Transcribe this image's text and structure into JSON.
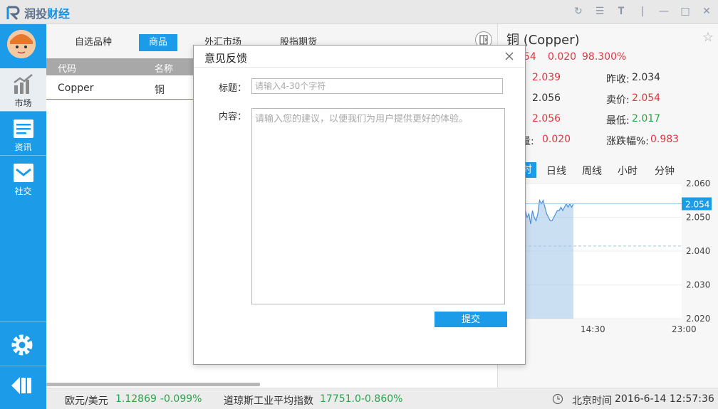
{
  "app": {
    "logo_part1": "润投",
    "logo_part2": "财经"
  },
  "window_controls": [
    "refresh-icon",
    "menu-icon",
    "font-size-icon",
    "minimize-icon",
    "maximize-icon",
    "close-icon"
  ],
  "sidebar": {
    "items": [
      {
        "label": "市场",
        "icon": "chart-icon",
        "active": true
      },
      {
        "label": "资讯",
        "icon": "news-icon",
        "active": false
      },
      {
        "label": "社交",
        "icon": "mail-icon",
        "active": false
      }
    ]
  },
  "main": {
    "tabs": [
      {
        "label": "自选品种",
        "active": false
      },
      {
        "label": "商品",
        "active": true
      },
      {
        "label": "外汇市场",
        "active": false
      },
      {
        "label": "股指期货",
        "active": false
      }
    ],
    "columns": [
      "代码",
      "名称"
    ],
    "rows": [
      {
        "code": "Copper",
        "name": "铜"
      }
    ]
  },
  "status_bar": {
    "fx_label": "欧元/美元",
    "fx_value": "1.12869",
    "fx_change": "-0.099%",
    "index_label": "道琼斯工业平均指数",
    "index_value": "17751.0",
    "index_change": "-0.860%",
    "time_label": "北京时间",
    "time_value": "2016-6-14 12:57:36"
  },
  "quote": {
    "title": "铜 (Copper)",
    "price_partial": "54",
    "change": "0.020",
    "change_pct": "98.300%",
    "open_value": "2.039",
    "prev_close_label": "昨收:",
    "prev_close_value": "2.034",
    "bid_value": "2.056",
    "ask_label": "卖价:",
    "ask_value": "2.054",
    "high_value": "2.056",
    "low_label": "最低:",
    "low_value": "2.017",
    "volume_label_partial": "量:",
    "volume_value": "0.020",
    "range_pct_label": "涨跌幅%:",
    "range_pct_value": "0.983",
    "periods": [
      {
        "label": "时",
        "active": true
      },
      {
        "label": "日线",
        "active": false
      },
      {
        "label": "周线",
        "active": false
      },
      {
        "label": "小时",
        "active": false
      },
      {
        "label": "分钟",
        "active": false
      }
    ],
    "colors": {
      "up": "#e0373f",
      "down": "#2aa34a",
      "accent": "#1c9be8"
    }
  },
  "chart_data": {
    "type": "area",
    "y_ticks": [
      "2.060",
      "2.050",
      "2.040",
      "2.030",
      "2.020"
    ],
    "ylim": [
      2.02,
      2.06
    ],
    "x_ticks": [
      "14:30",
      "23:00"
    ],
    "current_price_label": "2.054",
    "reference_line": 2.0415,
    "x": [
      0,
      1,
      2,
      3,
      4,
      5,
      6,
      7,
      8,
      9,
      10,
      11,
      12,
      13,
      14,
      15,
      16,
      17,
      18,
      19,
      20,
      21,
      22,
      23,
      24,
      25,
      26,
      27,
      28
    ],
    "values": [
      2.054,
      2.052,
      2.05,
      2.051,
      2.048,
      2.052,
      2.05,
      2.049,
      2.051,
      2.055,
      2.054,
      2.055,
      2.053,
      2.051,
      2.05,
      2.049,
      2.049,
      2.05,
      2.051,
      2.052,
      2.052,
      2.053,
      2.052,
      2.053,
      2.054,
      2.053,
      2.054,
      2.053,
      2.054
    ]
  },
  "dialog": {
    "title": "意见反馈",
    "title_label": "标题：",
    "title_placeholder": "请输入4-30个字符",
    "content_label": "内容：",
    "content_placeholder": "请输入您的建议，以便我们为用户提供更好的体验。",
    "submit_label": "提交"
  }
}
